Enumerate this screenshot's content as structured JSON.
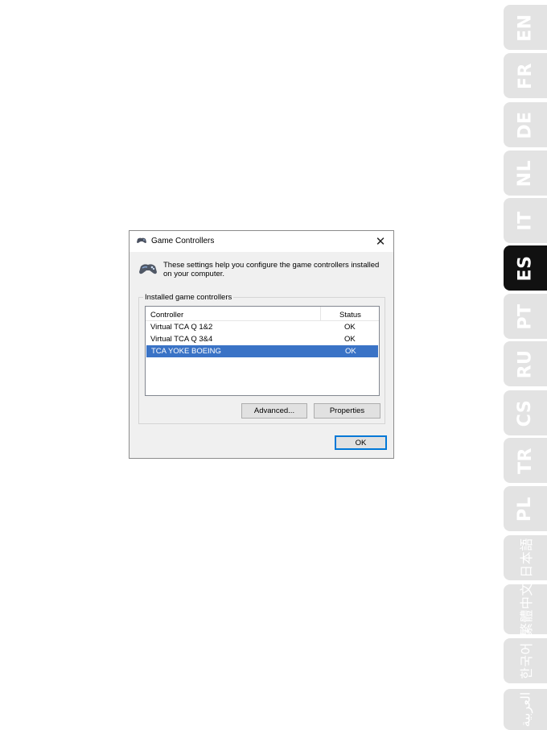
{
  "language_tabs": [
    {
      "code": "EN",
      "active": false
    },
    {
      "code": "FR",
      "active": false
    },
    {
      "code": "DE",
      "active": false
    },
    {
      "code": "NL",
      "active": false
    },
    {
      "code": "IT",
      "active": false
    },
    {
      "code": "ES",
      "active": true
    },
    {
      "code": "PT",
      "active": false
    },
    {
      "code": "RU",
      "active": false
    },
    {
      "code": "CS",
      "active": false
    },
    {
      "code": "TR",
      "active": false
    },
    {
      "code": "PL",
      "active": false
    },
    {
      "code": "日本語",
      "active": false
    },
    {
      "code": "繁體中文",
      "active": false
    },
    {
      "code": "한국어",
      "active": false
    },
    {
      "code": "العربية",
      "active": false
    }
  ],
  "dialog": {
    "title": "Game Controllers",
    "close_symbol": "✕",
    "title_icon": "gamepad-icon",
    "intro_icon": "gamepad-icon",
    "intro_text": "These settings help you configure the game controllers installed on your computer.",
    "group_label": "Installed game controllers",
    "columns": {
      "controller": "Controller",
      "status": "Status"
    },
    "rows": [
      {
        "name": "Virtual TCA Q 1&2",
        "status": "OK",
        "selected": false
      },
      {
        "name": "Virtual TCA Q 3&4",
        "status": "OK",
        "selected": false
      },
      {
        "name": "TCA YOKE BOEING",
        "status": "OK",
        "selected": true
      }
    ],
    "buttons": {
      "advanced": "Advanced...",
      "properties": "Properties",
      "ok": "OK"
    }
  },
  "colors": {
    "tab_inactive": "#e3e3e3",
    "tab_active": "#111111",
    "selection": "#3a73c6",
    "focus_border": "#0078d7"
  }
}
